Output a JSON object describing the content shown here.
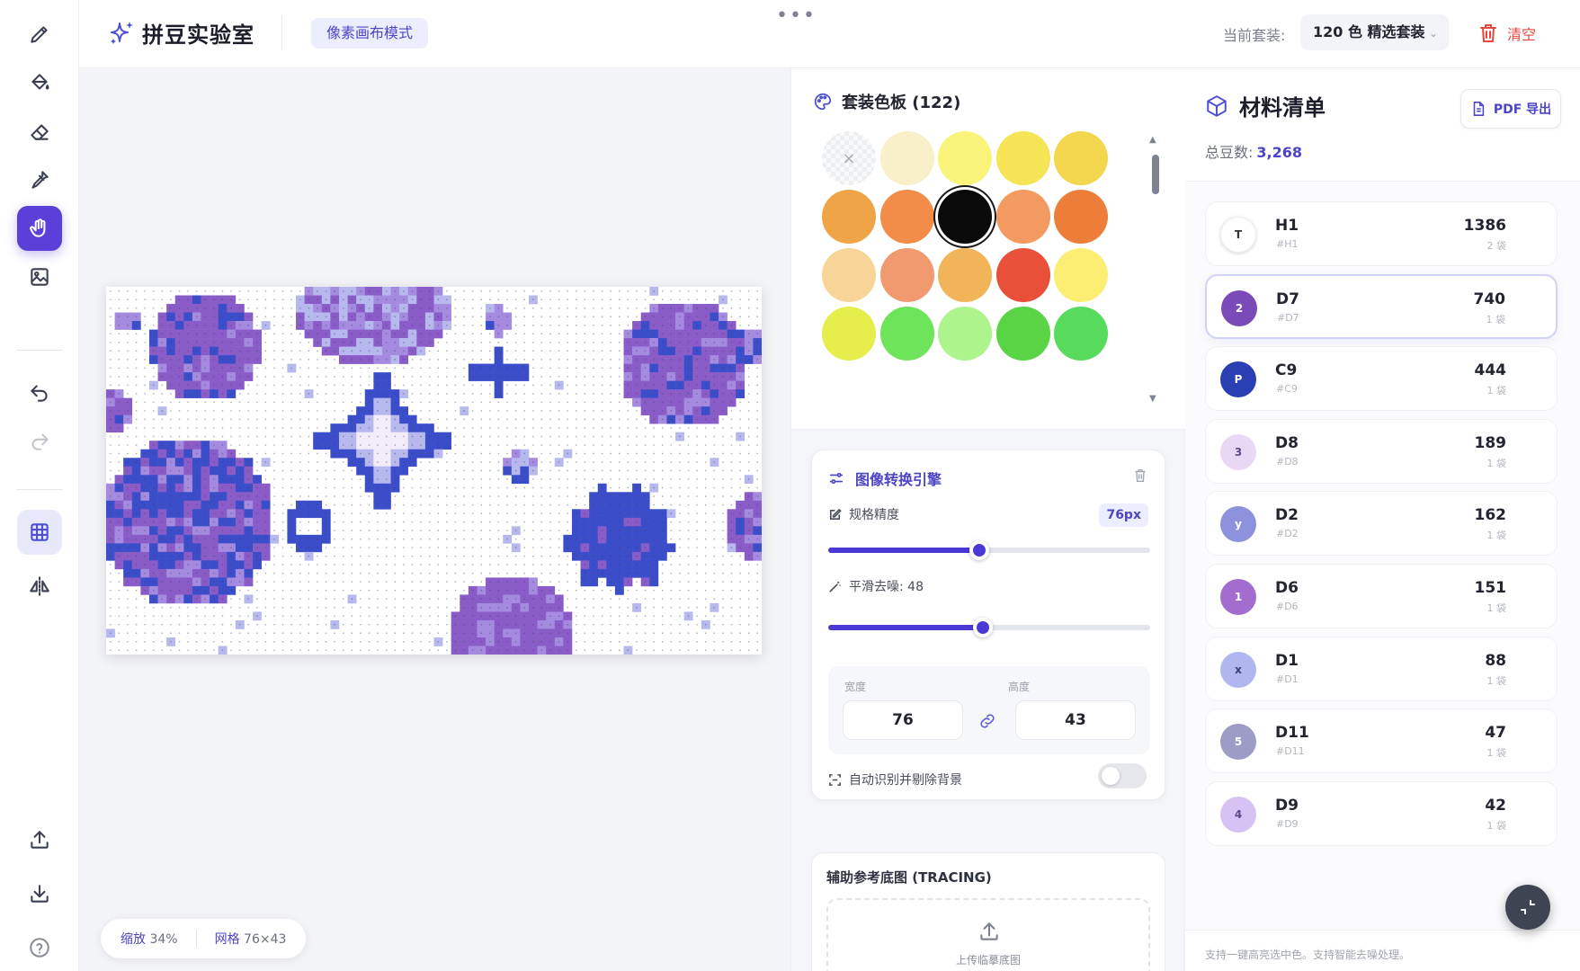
{
  "header": {
    "title": "拼豆实验室",
    "mode_badge": "像素画布模式",
    "more": "•••",
    "kit_label": "当前套装:",
    "kit_value": "120 色 精选套装",
    "clear_label": "清空"
  },
  "toolbar": {
    "tools": [
      "pencil-icon",
      "paint-bucket-icon",
      "eraser-icon",
      "eyedropper-icon",
      "hand-icon",
      "image-icon",
      "undo-icon",
      "redo-icon",
      "grid-icon",
      "mirror-icon",
      "upload-icon",
      "download-icon",
      "help-icon"
    ],
    "active_tool": "hand-icon"
  },
  "canvas": {
    "zoom_label": "缩放",
    "zoom_value": "34%",
    "grid_label": "网格",
    "grid_value": "76×43",
    "grid_cols": 76,
    "grid_rows": 43
  },
  "palette": {
    "title": "套装色板 (122)",
    "none_symbol": "×",
    "selected_index": 7,
    "swatches": [
      "none",
      "#f8f0c8",
      "#fbf47a",
      "#f5e455",
      "#f2d64e",
      "#f0a448",
      "#f28c48",
      "#0a0a0a",
      "#f39a60",
      "#ec7e3a",
      "#f8d498",
      "#f19a70",
      "#f2b458",
      "#e8503a",
      "#fbee72",
      "#e6ee4c",
      "#6ee45a",
      "#aef48c",
      "#58d444",
      "#58da5c"
    ]
  },
  "engine": {
    "title": "图像转换引擎",
    "precision_label": "规格精度",
    "precision_value": "76px",
    "precision_fraction": 0.47,
    "smooth_label": "平滑去噪: 48",
    "smooth_fraction": 0.48,
    "width_label": "宽度",
    "width_value": "76",
    "height_label": "高度",
    "height_value": "43",
    "bg_label": "自动识别并剔除背景",
    "bg_enabled": false
  },
  "tracing": {
    "title": "辅助参考底图 (TRACING)",
    "upload_text": "上传临摹底图"
  },
  "materials": {
    "title": "材料清单",
    "pdf_label": "PDF 导出",
    "total_label": "总豆数:",
    "total_value": "3,268",
    "footer_text": "支持一键高亮选中色。支持智能去噪处理。",
    "selected_index": 1,
    "items": [
      {
        "symbol": "T",
        "code": "H1",
        "sub": "#H1",
        "count": "1386",
        "bags": "2 袋",
        "color": "#ffffff",
        "text": "#333333"
      },
      {
        "symbol": "2",
        "code": "D7",
        "sub": "#D7",
        "count": "740",
        "bags": "1 袋",
        "color": "#7a4bb8",
        "text": "#ffffff"
      },
      {
        "symbol": "P",
        "code": "C9",
        "sub": "#C9",
        "count": "444",
        "bags": "1 袋",
        "color": "#2a3fb4",
        "text": "#ffffff"
      },
      {
        "symbol": "3",
        "code": "D8",
        "sub": "#D8",
        "count": "189",
        "bags": "1 袋",
        "color": "#e8d8f6",
        "text": "#5a4a8a"
      },
      {
        "symbol": "y",
        "code": "D2",
        "sub": "#D2",
        "count": "162",
        "bags": "1 袋",
        "color": "#8c92dc",
        "text": "#ffffff"
      },
      {
        "symbol": "1",
        "code": "D6",
        "sub": "#D6",
        "count": "151",
        "bags": "1 袋",
        "color": "#a36dd0",
        "text": "#ffffff"
      },
      {
        "symbol": "x",
        "code": "D1",
        "sub": "#D1",
        "count": "88",
        "bags": "1 袋",
        "color": "#b0b6ee",
        "text": "#3a3f7a"
      },
      {
        "symbol": "5",
        "code": "D11",
        "sub": "#D11",
        "count": "47",
        "bags": "1 袋",
        "color": "#9c9cc6",
        "text": "#ffffff"
      },
      {
        "symbol": "4",
        "code": "D9",
        "sub": "#D9",
        "count": "42",
        "bags": "1 袋",
        "color": "#d7c2f4",
        "text": "#5a4a8a"
      }
    ]
  }
}
